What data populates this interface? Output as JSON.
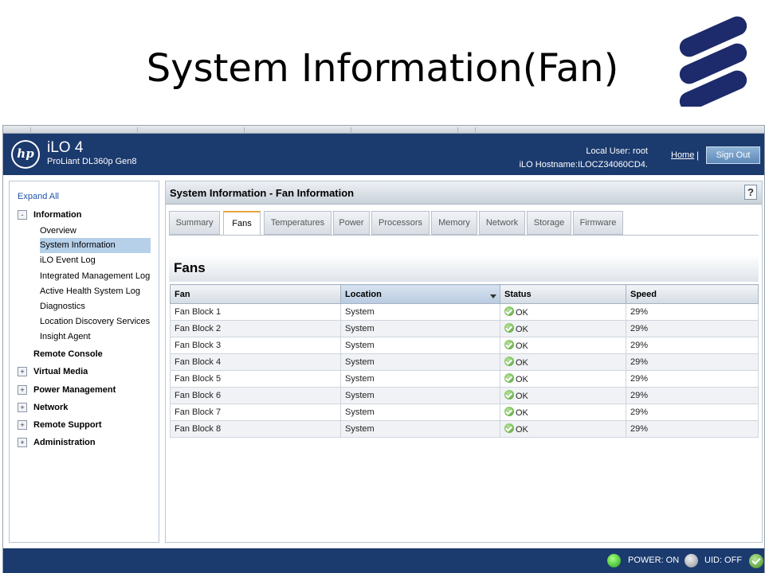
{
  "slide": {
    "title": "System Information(Fan)"
  },
  "header": {
    "product": "iLO 4",
    "server": "ProLiant DL360p Gen8",
    "local_user": "Local User:  root",
    "hostname": "iLO Hostname:ILOCZ34060CD4.",
    "home": "Home",
    "sign_out": "Sign Out",
    "hp_logo_text": "hp"
  },
  "sidebar": {
    "expand_all": "Expand All",
    "information": "Information",
    "information_toggle": "-",
    "info_items": [
      "Overview",
      "System Information",
      "iLO Event Log",
      "Integrated Management Log",
      "Active Health System Log",
      "Diagnostics",
      "Location Discovery Services",
      "Insight Agent"
    ],
    "remote_console": "Remote Console",
    "groups": [
      "Virtual Media",
      "Power Management",
      "Network",
      "Remote Support",
      "Administration"
    ],
    "group_toggle": "+"
  },
  "content": {
    "title": "System Information - Fan Information",
    "help": "?",
    "tabs": [
      "Summary",
      "Fans",
      "Temperatures",
      "Power",
      "Processors",
      "Memory",
      "Network",
      "Storage",
      "Firmware"
    ],
    "section": "Fans",
    "columns": [
      "Fan",
      "Location",
      "Status",
      "Speed"
    ],
    "rows": [
      [
        "Fan Block 1",
        "System",
        "OK",
        "29%"
      ],
      [
        "Fan Block 2",
        "System",
        "OK",
        "29%"
      ],
      [
        "Fan Block 3",
        "System",
        "OK",
        "29%"
      ],
      [
        "Fan Block 4",
        "System",
        "OK",
        "29%"
      ],
      [
        "Fan Block 5",
        "System",
        "OK",
        "29%"
      ],
      [
        "Fan Block 6",
        "System",
        "OK",
        "29%"
      ],
      [
        "Fan Block 7",
        "System",
        "OK",
        "29%"
      ],
      [
        "Fan Block 8",
        "System",
        "OK",
        "29%"
      ]
    ]
  },
  "footer": {
    "power": "POWER: ON",
    "uid": "UID: OFF"
  },
  "colors": {
    "header_bg": "#1b3a6e",
    "logo_blue": "#1d2a6b",
    "ok_green": "#4c9a2a",
    "active_tab_accent": "#e7a53a"
  }
}
